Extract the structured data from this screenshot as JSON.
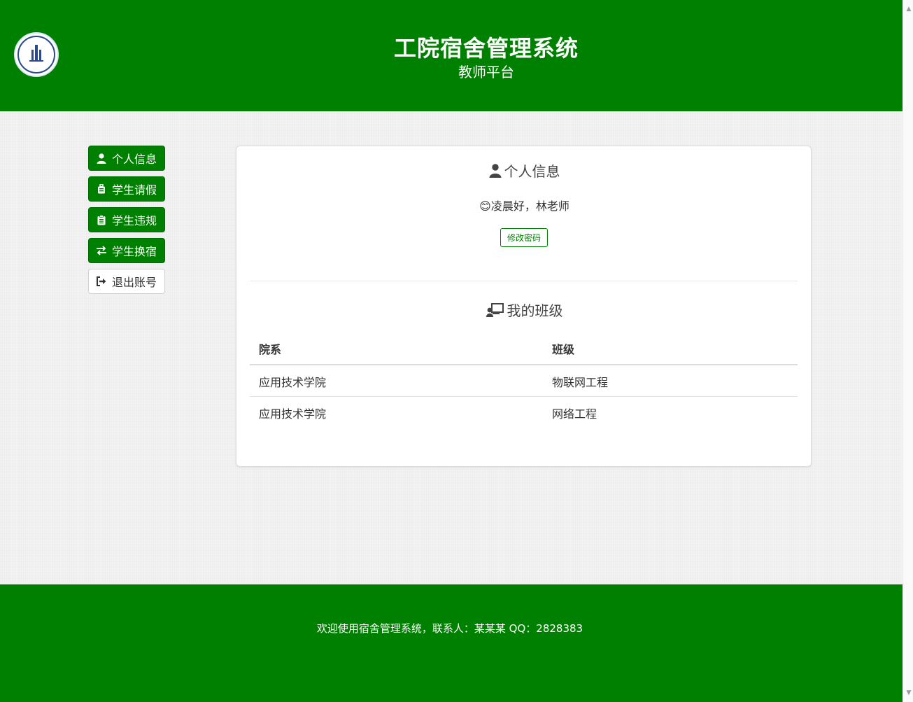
{
  "header": {
    "title": "工院宿舍管理系统",
    "subtitle": "教师平台",
    "logo_icon": "school-seal"
  },
  "sidebar": {
    "items": [
      {
        "label": "个人信息",
        "icon": "user-icon"
      },
      {
        "label": "学生请假",
        "icon": "suitcase-icon"
      },
      {
        "label": "学生违规",
        "icon": "clipboard-icon"
      },
      {
        "label": "学生换宿",
        "icon": "exchange-icon"
      },
      {
        "label": "退出账号",
        "icon": "sign-out-icon"
      }
    ]
  },
  "profile": {
    "title": "个人信息",
    "greeting": "😊凌晨好，林老师",
    "change_password": "修改密码"
  },
  "classes": {
    "title": "我的班级",
    "headers": [
      "院系",
      "班级"
    ],
    "rows": [
      [
        "应用技术学院",
        "物联网工程"
      ],
      [
        "应用技术学院",
        "网络工程"
      ]
    ]
  },
  "footer": {
    "text": "欢迎使用宿舍管理系统，联系人：某某某 QQ：2828383"
  },
  "colors": {
    "brand_green": "#008000",
    "background": "#f2f2f2"
  }
}
